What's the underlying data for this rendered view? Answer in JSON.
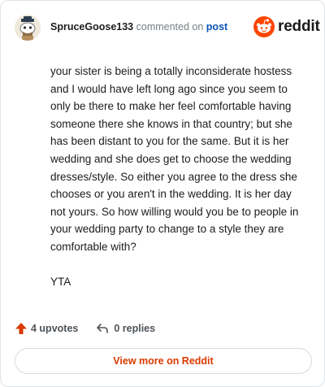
{
  "header": {
    "username": "SpruceGoose133",
    "action_text": "commented on",
    "post_link": "post",
    "avatar_icon": "snoo-avatar-icon"
  },
  "brand": {
    "logo_icon": "reddit-snoo-icon",
    "name": "reddit",
    "color": "#ff4500"
  },
  "comment": {
    "paragraphs": [
      "your sister is being a totally inconsiderate hostess and I would have left long ago since you seem to only be there to make her feel comfortable having someone there she knows in that country; but she has been distant to you for the same. But it is her wedding and she does get to choose the wedding dresses/style. So either you agree to the dress she chooses or you aren't in the wedding. It is her day not yours. So how willing would you be to people in your wedding party to change to a style they are comfortable with?",
      "YTA"
    ]
  },
  "footer": {
    "upvotes_label": "4 upvotes",
    "replies_label": "0 replies",
    "upvote_icon": "upvote-arrow-icon",
    "reply_icon": "reply-arrow-icon",
    "accent": "#d93a00"
  },
  "view_more": {
    "label": "View more on Reddit"
  }
}
